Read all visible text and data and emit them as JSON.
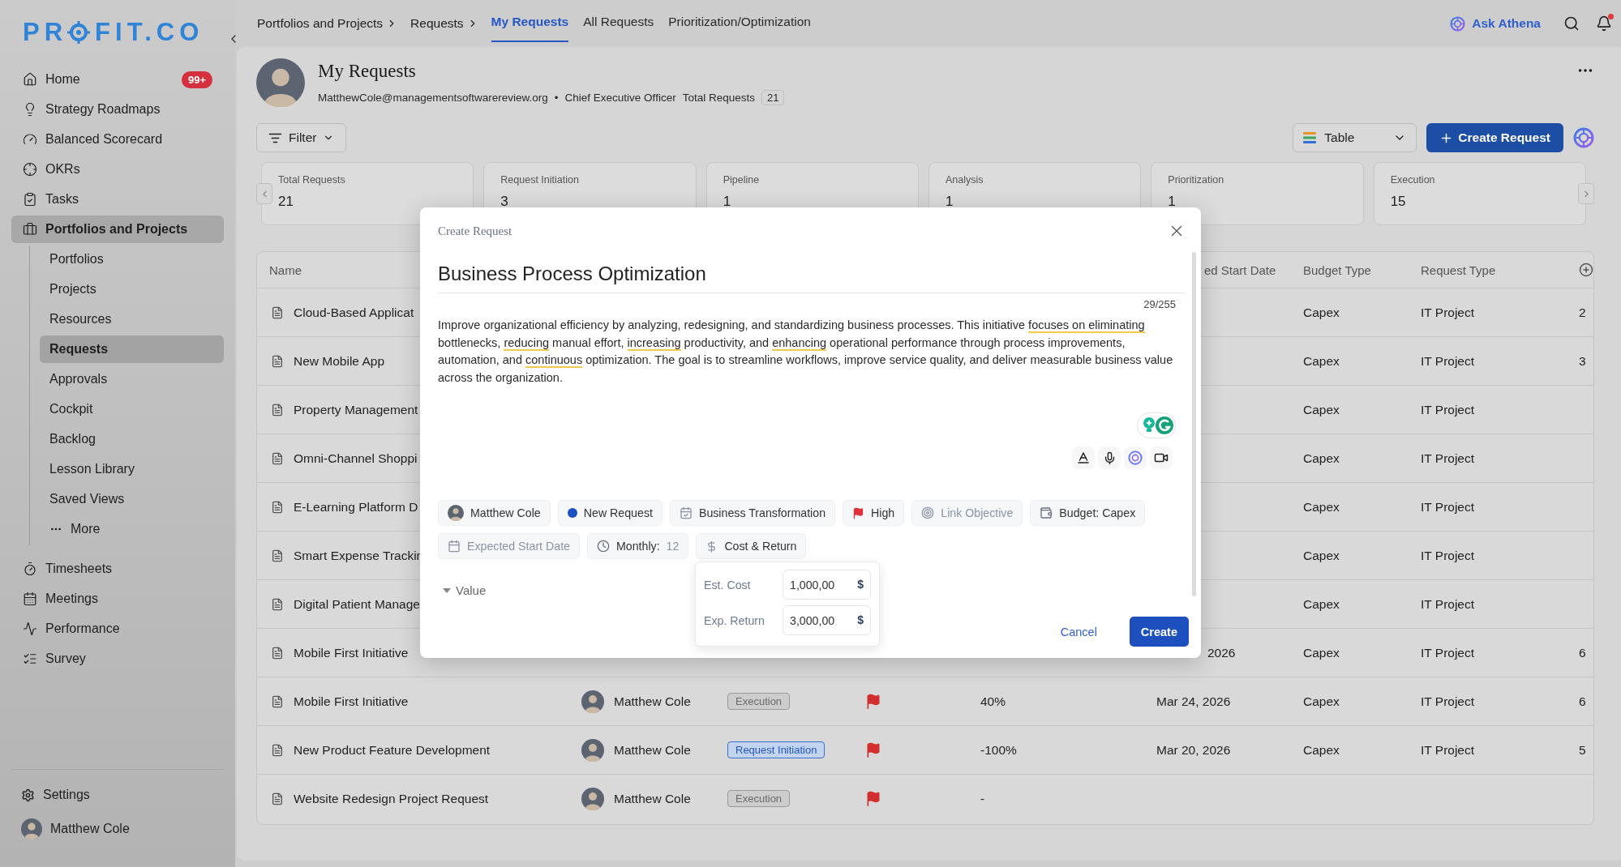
{
  "logo": {
    "left": "PR",
    "right": "FIT.CO"
  },
  "sidebar": {
    "items": [
      {
        "label": "Home",
        "badge": "99+",
        "selected": false
      },
      {
        "label": "Strategy Roadmaps",
        "selected": false
      },
      {
        "label": "Balanced Scorecard",
        "selected": false
      },
      {
        "label": "OKRs",
        "selected": false
      },
      {
        "label": "Tasks",
        "selected": false
      },
      {
        "label": "Portfolios and Projects",
        "selected": true,
        "children": [
          {
            "label": "Portfolios",
            "kind": "link",
            "selected": false
          },
          {
            "label": "Projects",
            "kind": "link",
            "selected": false
          },
          {
            "label": "Resources",
            "kind": "link",
            "selected": false
          },
          {
            "label": "Requests",
            "kind": "link",
            "selected": true
          },
          {
            "label": "Approvals",
            "kind": "link",
            "selected": false
          },
          {
            "label": "Cockpit",
            "kind": "link",
            "selected": false
          },
          {
            "label": "Backlog",
            "kind": "link",
            "selected": false
          },
          {
            "label": "Lesson Library",
            "kind": "link",
            "selected": false
          },
          {
            "label": "Saved Views",
            "kind": "link",
            "selected": false
          },
          {
            "label": "More",
            "kind": "more",
            "selected": false
          }
        ]
      },
      {
        "label": "Timesheets",
        "selected": false
      },
      {
        "label": "Meetings",
        "selected": false
      },
      {
        "label": "Performance",
        "selected": false
      },
      {
        "label": "Survey",
        "selected": false
      }
    ],
    "footer": [
      {
        "kind": "settings",
        "label": "Settings"
      },
      {
        "kind": "user",
        "label": "Matthew Cole"
      }
    ]
  },
  "nav": {
    "breadcrumbs": [
      "Portfolios and Projects",
      "Requests"
    ],
    "tabs": [
      {
        "label": "My Requests",
        "selected": true
      },
      {
        "label": "All Requests",
        "selected": false
      },
      {
        "label": "Prioritization/Optimization",
        "selected": false
      }
    ],
    "assistant": "Ask Athena",
    "notifications_unread": true
  },
  "header": {
    "title": "My Requests",
    "email": "MatthewCole@managementsoftwarereview.org",
    "separator": "•",
    "role": "Chief Executive Officer",
    "total_label": "Total Requests",
    "total": "21"
  },
  "toolbar": {
    "filter": "Filter",
    "view": "Table",
    "create": "Create Request"
  },
  "stats": [
    {
      "label": "Total Requests",
      "value": "21"
    },
    {
      "label": "Request Initiation",
      "value": "3"
    },
    {
      "label": "Pipeline",
      "value": "1"
    },
    {
      "label": "Analysis",
      "value": "1"
    },
    {
      "label": "Prioritization",
      "value": "1"
    },
    {
      "label": "Execution",
      "value": "15"
    }
  ],
  "table": {
    "columns": {
      "name": "Name",
      "start_date": "ed Start Date",
      "budget_type": "Budget Type",
      "request_type": "Request Type"
    },
    "rows": [
      {
        "name": "Cloud-Based Applicat",
        "budget_type": "Capex",
        "request_type": "IT Project",
        "column_9": "2"
      },
      {
        "name": "New Mobile App",
        "budget_type": "Capex",
        "request_type": "IT Project",
        "column_9": "3"
      },
      {
        "name": "Property Management",
        "budget_type": "Capex",
        "request_type": "IT Project"
      },
      {
        "name": "Omni-Channel Shoppi",
        "budget_type": "Capex",
        "request_type": "IT Project"
      },
      {
        "name": "E-Learning Platform D",
        "budget_type": "Capex",
        "request_type": "IT Project"
      },
      {
        "name": "Smart Expense Trackin",
        "budget_type": "Capex",
        "request_type": "IT Project"
      },
      {
        "name": "Digital Patient Manage",
        "budget_type": "Capex",
        "request_type": "IT Project"
      },
      {
        "name": "Mobile First Initiative",
        "start_date": "2026",
        "budget_type": "Capex",
        "request_type": "IT Project",
        "column_9": "6"
      },
      {
        "name": "Mobile First Initiative",
        "owner": "Matthew Cole",
        "stage": {
          "label": "Execution",
          "kind": "execution"
        },
        "flagged": true,
        "progress": "40%",
        "start_date": "Mar 24, 2026",
        "budget_type": "Capex",
        "request_type": "IT Project",
        "column_9": "6"
      },
      {
        "name": "New Product Feature Development",
        "owner": "Matthew Cole",
        "stage": {
          "label": "Request Initiation",
          "kind": "initiation"
        },
        "flagged": true,
        "progress": "-100%",
        "start_date": "Mar 20, 2026",
        "budget_type": "Capex",
        "request_type": "IT Project",
        "column_9": "5"
      },
      {
        "name": "Website Redesign Project Request",
        "owner": "Matthew Cole",
        "stage": {
          "label": "Execution",
          "kind": "execution"
        },
        "flagged": true,
        "progress": "-"
      }
    ]
  },
  "modal": {
    "title": "Create Request",
    "name": "Business Process Optimization",
    "counter": "29/255",
    "description": [
      {
        "text": "Improve organizational efficiency by analyzing, redesigning, and standardizing business processes. This initiative ",
        "flagged": false
      },
      {
        "text": "focuses on eliminating",
        "flagged": true
      },
      {
        "text": " bottlenecks, ",
        "flagged": false
      },
      {
        "text": "reducing",
        "flagged": true
      },
      {
        "text": " manual effort, ",
        "flagged": false
      },
      {
        "text": "increasing",
        "flagged": true
      },
      {
        "text": " productivity, and ",
        "flagged": false
      },
      {
        "text": "enhancing",
        "flagged": true
      },
      {
        "text": " operational performance through process improvements, automation, and ",
        "flagged": false
      },
      {
        "text": "continuous",
        "flagged": true
      },
      {
        "text": " optimization. The goal is to streamline workflows, improve service quality, and deliver measurable business value across the organization.",
        "flagged": false
      }
    ],
    "chip_rows": [
      [
        {
          "kind": "owner",
          "label": "Matthew Cole",
          "empty": false
        },
        {
          "kind": "status",
          "label": "New Request",
          "color": "#1d4fc4",
          "empty": false
        },
        {
          "kind": "category",
          "label": "Business Transformation",
          "empty": false
        },
        {
          "kind": "priority",
          "label": "High",
          "empty": false
        },
        {
          "kind": "objective",
          "label": "Link Objective",
          "empty": true
        },
        {
          "kind": "budget",
          "label": "Budget: Capex",
          "empty": false
        }
      ],
      [
        {
          "kind": "date",
          "label": "Expected Start Date",
          "empty": true
        },
        {
          "kind": "frequency",
          "label": "Monthly:",
          "value": "12",
          "empty": false
        },
        {
          "kind": "cost",
          "label": "Cost & Return",
          "empty": false
        }
      ]
    ],
    "section": {
      "label": "Value",
      "expanded": true
    },
    "popup": [
      {
        "label": "Est. Cost",
        "value": "1,000,00",
        "unit": "$"
      },
      {
        "label": "Exp. Return",
        "value": "3,000,00",
        "unit": "$"
      }
    ],
    "cancel": "Cancel",
    "submit": "Create"
  }
}
